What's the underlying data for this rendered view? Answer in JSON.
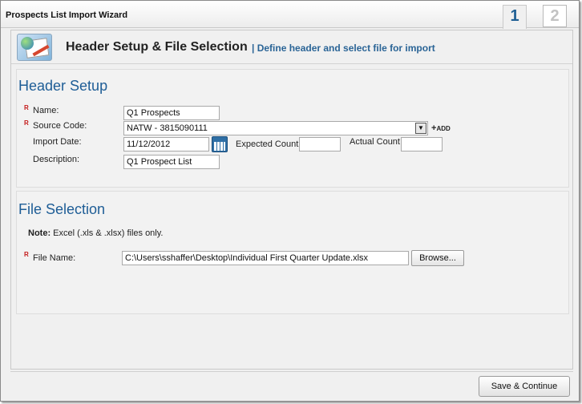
{
  "window": {
    "title": "Prospects List Import Wizard",
    "steps": [
      "1",
      "2"
    ]
  },
  "header": {
    "title": "Header Setup & File Selection",
    "subtitle": "| Define header and select file for import"
  },
  "header_setup": {
    "section_title": "Header Setup",
    "required_marker": "R",
    "name_label": "Name:",
    "name_value": "Q1 Prospects",
    "source_code_label": "Source Code:",
    "source_code_value": "NATW - 3815090111",
    "add_label": "ADD",
    "add_plus": "+",
    "import_date_label": "Import Date:",
    "import_date_value": "11/12/2012",
    "expected_count_label": "Expected Count:",
    "expected_count_value": "",
    "actual_count_label": "Actual Count:",
    "actual_count_value": "",
    "description_label": "Description:",
    "description_value": "Q1 Prospect List"
  },
  "file_selection": {
    "section_title": "File Selection",
    "note_bold": "Note:",
    "note_text": " Excel (.xls & .xlsx) files only.",
    "file_name_label": "File Name:",
    "file_name_value": "C:\\Users\\sshaffer\\Desktop\\Individual First Quarter Update.xlsx",
    "browse_label": "Browse..."
  },
  "footer": {
    "save_continue_label": "Save & Continue"
  },
  "colors": {
    "accent": "#1e5d96",
    "required": "#c41a1a",
    "active_step": "#1f5f94",
    "inactive_step": "#c2c2c2"
  },
  "icons": [
    "wizard-header-icon",
    "calendar-icon",
    "dropdown-arrow-icon",
    "add-plus-icon"
  ]
}
